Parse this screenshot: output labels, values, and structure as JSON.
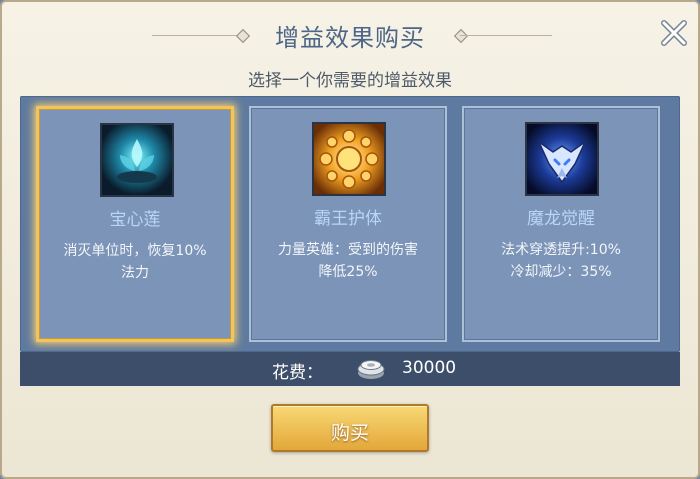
{
  "dialog": {
    "title": "增益效果购买",
    "subtitle": "选择一个你需要的增益效果"
  },
  "cards": [
    {
      "name": "宝心莲",
      "desc": "消灭单位时，恢复10%\n法力",
      "icon": "blue-lotus-icon",
      "selected": true
    },
    {
      "name": "霸王护体",
      "desc": "力量英雄：受到的伤害\n降低25%",
      "icon": "golden-shield-orb-icon",
      "selected": false
    },
    {
      "name": "魔龙觉醒",
      "desc": "法术穿透提升:10%\n冷却减少：35%",
      "icon": "dragon-head-icon",
      "selected": false
    }
  ],
  "cost": {
    "label": "花费：",
    "value": "30000",
    "icon": "silver-coin-icon"
  },
  "buy_button": {
    "label": "购买"
  },
  "colors": {
    "title": "#4d6587",
    "card_name": "#b9d6f7",
    "selected_border": "#f0c560",
    "button": "#e9b74e"
  }
}
